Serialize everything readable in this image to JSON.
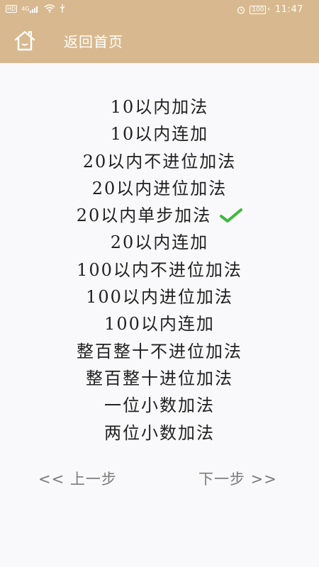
{
  "status_bar": {
    "left_label": "HD",
    "signal_label": "4G",
    "battery": "100",
    "time": "11:47"
  },
  "header": {
    "back_label": "返回首页"
  },
  "menu": {
    "items": [
      {
        "label": "10以内加法"
      },
      {
        "label": "10以内连加"
      },
      {
        "label": "20以内不进位加法"
      },
      {
        "label": "20以内进位加法"
      },
      {
        "label": "20以内单步加法"
      },
      {
        "label": "20以内连加"
      },
      {
        "label": "100以内不进位加法"
      },
      {
        "label": "100以内进位加法"
      },
      {
        "label": "100以内连加"
      },
      {
        "label": "整百整十不进位加法"
      },
      {
        "label": "整百整十进位加法"
      },
      {
        "label": "一位小数加法"
      },
      {
        "label": "两位小数加法"
      }
    ],
    "selected_index": 4
  },
  "nav": {
    "prev_label": "<< 上一步",
    "next_label": "下一步 >>"
  },
  "colors": {
    "header_bg": "#d8b98f",
    "check": "#3cb93c",
    "nav_text": "#7b7b7b"
  }
}
